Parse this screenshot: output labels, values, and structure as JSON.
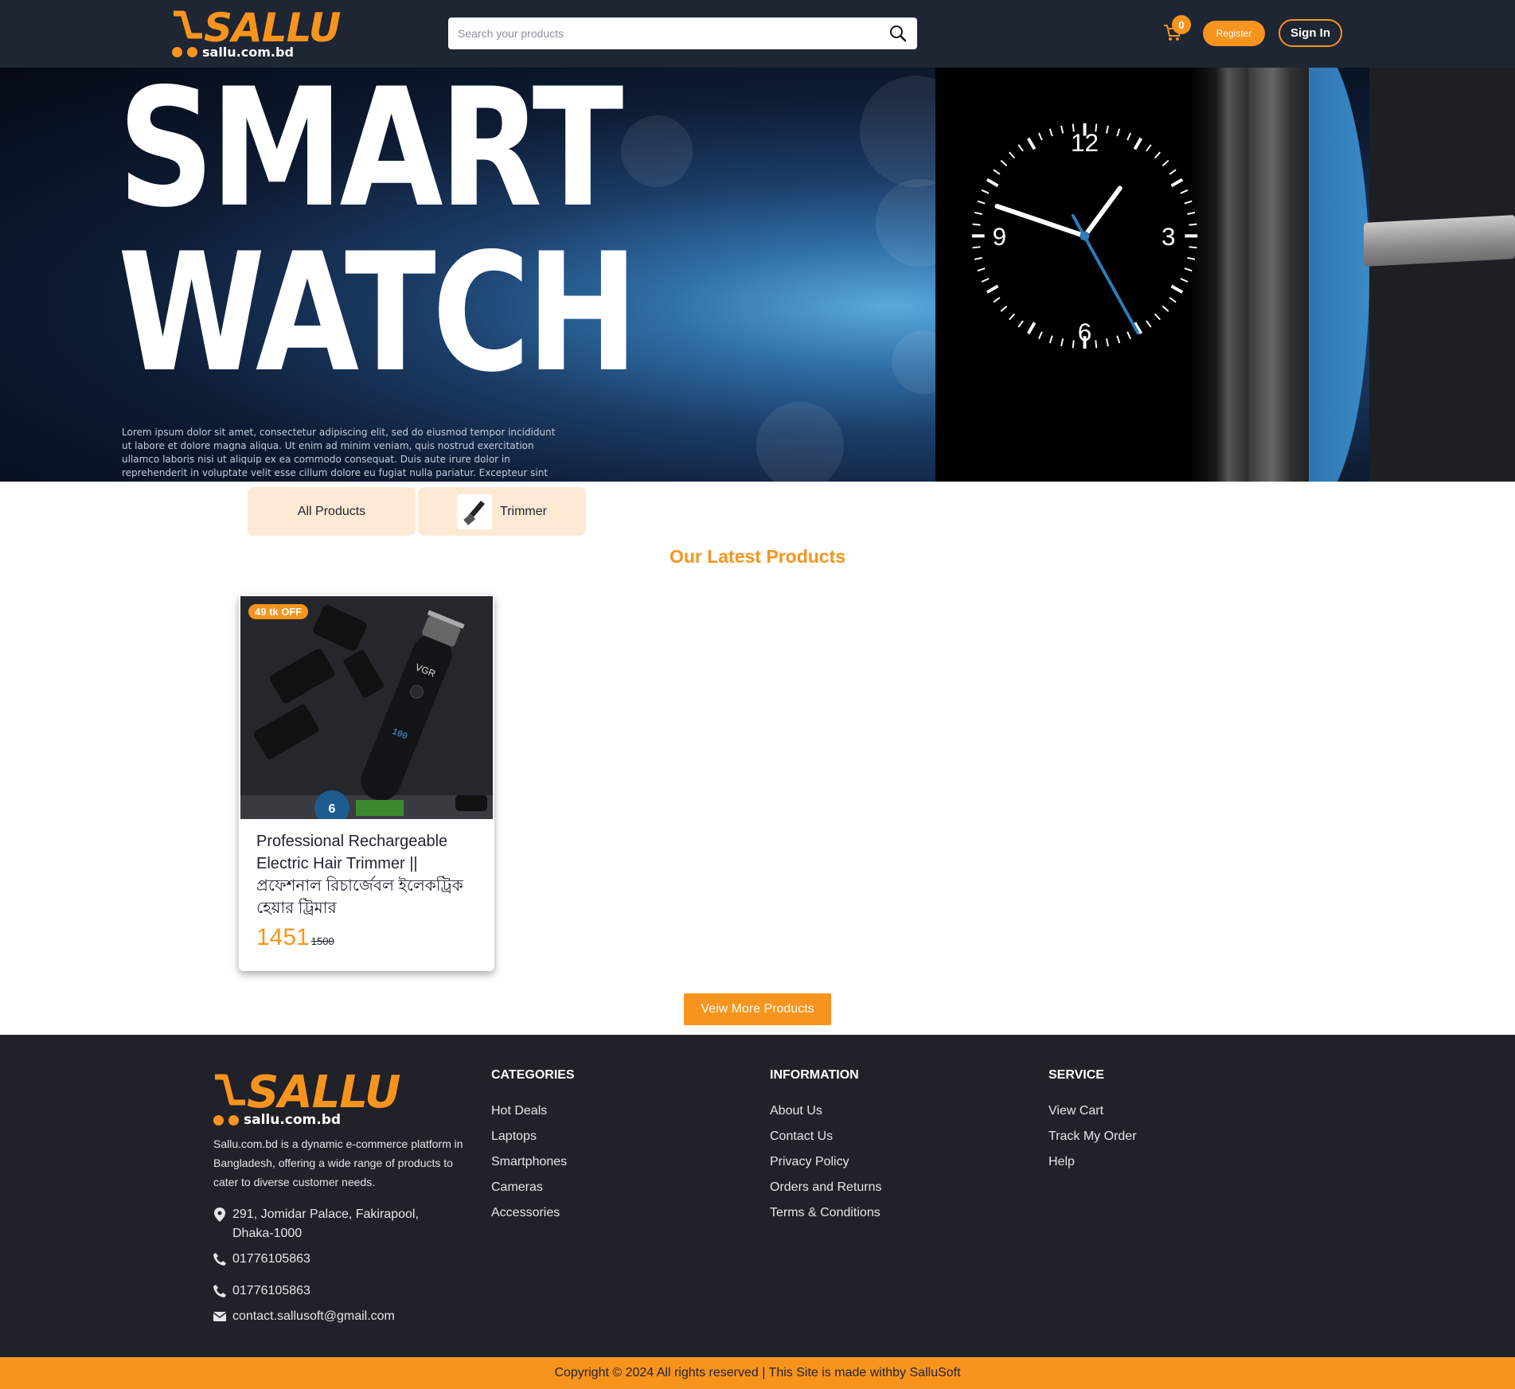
{
  "brand": {
    "name": "SALLU",
    "domain": "sallu.com.bd",
    "accent": "#f7941d",
    "dark": "#1e2533"
  },
  "header": {
    "search_placeholder": "Search your products",
    "cart_count": "0",
    "register_label": "Register",
    "signin_label": "Sign In"
  },
  "hero": {
    "title_line1": "SMART",
    "title_line2": "WATCH",
    "body": "Lorem ipsum dolor sit amet, consectetur adipiscing elit, sed do eiusmod tempor incididunt ut labore et dolore magna aliqua. Ut enim ad minim veniam, quis nostrud exercitation ullamco laboris nisi ut aliquip ex ea commodo consequat. Duis aute irure dolor in reprehenderit in voluptate velit esse cillum dolore eu fugiat nulla pariatur. Excepteur sint occaecat cupidatat",
    "clock_numbers": [
      "12",
      "3",
      "6",
      "9"
    ]
  },
  "categories": [
    {
      "label": "All Products",
      "icon": "none"
    },
    {
      "label": "Trimmer",
      "icon": "trimmer-thumbnail"
    }
  ],
  "section_title": "Our Latest Products",
  "products": [
    {
      "badge": "49 tk OFF",
      "title": "Professional Rechargeable Electric Hair Trimmer || প্রফেশনাল রিচার্জেবল ইলেকট্রিক হেয়ার ট্রিমার",
      "price": "1451",
      "old_price": "1500",
      "image_brand": "VGR",
      "image_display": "100",
      "warranty_months": "6"
    }
  ],
  "view_more_label": "Veiw More Products",
  "footer": {
    "description": "Sallu.com.bd is a dynamic e-commerce platform in Bangladesh, offering a wide range of products to cater to diverse customer needs.",
    "address": "291, Jomidar Palace, Fakirapool, Dhaka-1000",
    "phone1": "01776105863",
    "phone2": "01776105863",
    "email": "contact.sallusoft@gmail.com",
    "columns": [
      {
        "heading": "CATEGORIES",
        "items": [
          "Hot Deals",
          "Laptops",
          "Smartphones",
          "Cameras",
          "Accessories"
        ]
      },
      {
        "heading": "INFORMATION",
        "items": [
          "About Us",
          "Contact Us",
          "Privacy Policy",
          "Orders and Returns",
          "Terms & Conditions"
        ]
      },
      {
        "heading": "SERVICE",
        "items": [
          "View Cart",
          "Track My Order",
          "Help"
        ]
      }
    ],
    "copyright": "Copyright © 2024 All rights reserved | This Site is made withby SalluSoft"
  }
}
